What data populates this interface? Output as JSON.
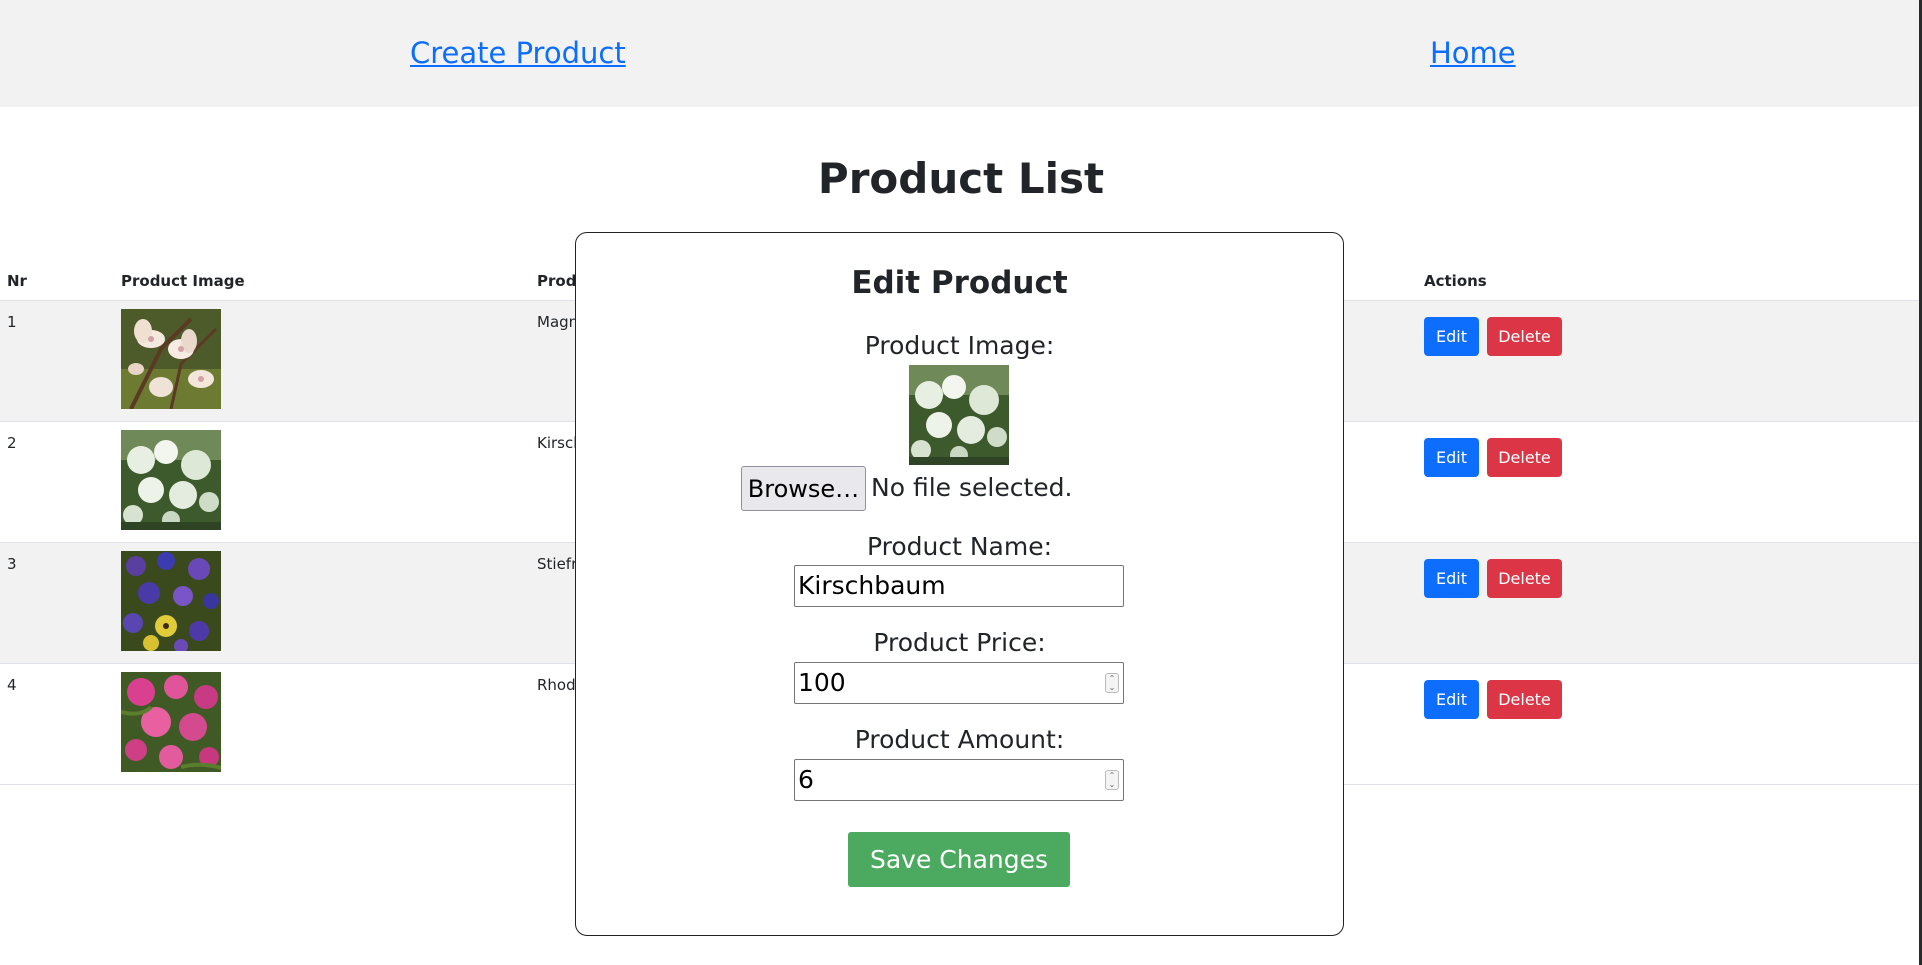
{
  "nav": {
    "create_label": "Create Product",
    "home_label": "Home"
  },
  "page": {
    "title": "Product List"
  },
  "table": {
    "headers": {
      "nr": "Nr",
      "image": "Product Image",
      "name": "Prod",
      "actions": "Actions"
    },
    "rows": [
      {
        "nr": "1",
        "name": "Magn",
        "image_icon": "magnolia-photo"
      },
      {
        "nr": "2",
        "name": "Kirsch",
        "image_icon": "cherry-blossom-photo"
      },
      {
        "nr": "3",
        "name": "Stiefr",
        "image_icon": "pansy-photo"
      },
      {
        "nr": "4",
        "name": "Rhod",
        "image_icon": "rhododendron-photo"
      }
    ],
    "edit_label": "Edit",
    "delete_label": "Delete"
  },
  "modal": {
    "title": "Edit Product",
    "image_label": "Product Image:",
    "browse_label": "Browse…",
    "file_status": "No file selected.",
    "name_label": "Product Name:",
    "name_value": "Kirschbaum",
    "price_label": "Product Price:",
    "price_value": "100",
    "amount_label": "Product Amount:",
    "amount_value": "6",
    "save_label": "Save Changes"
  },
  "colors": {
    "link": "#0d6efd",
    "edit": "#0d6efd",
    "delete": "#dc3545",
    "save": "#4caa60",
    "nav_bg": "#f2f2f2"
  }
}
